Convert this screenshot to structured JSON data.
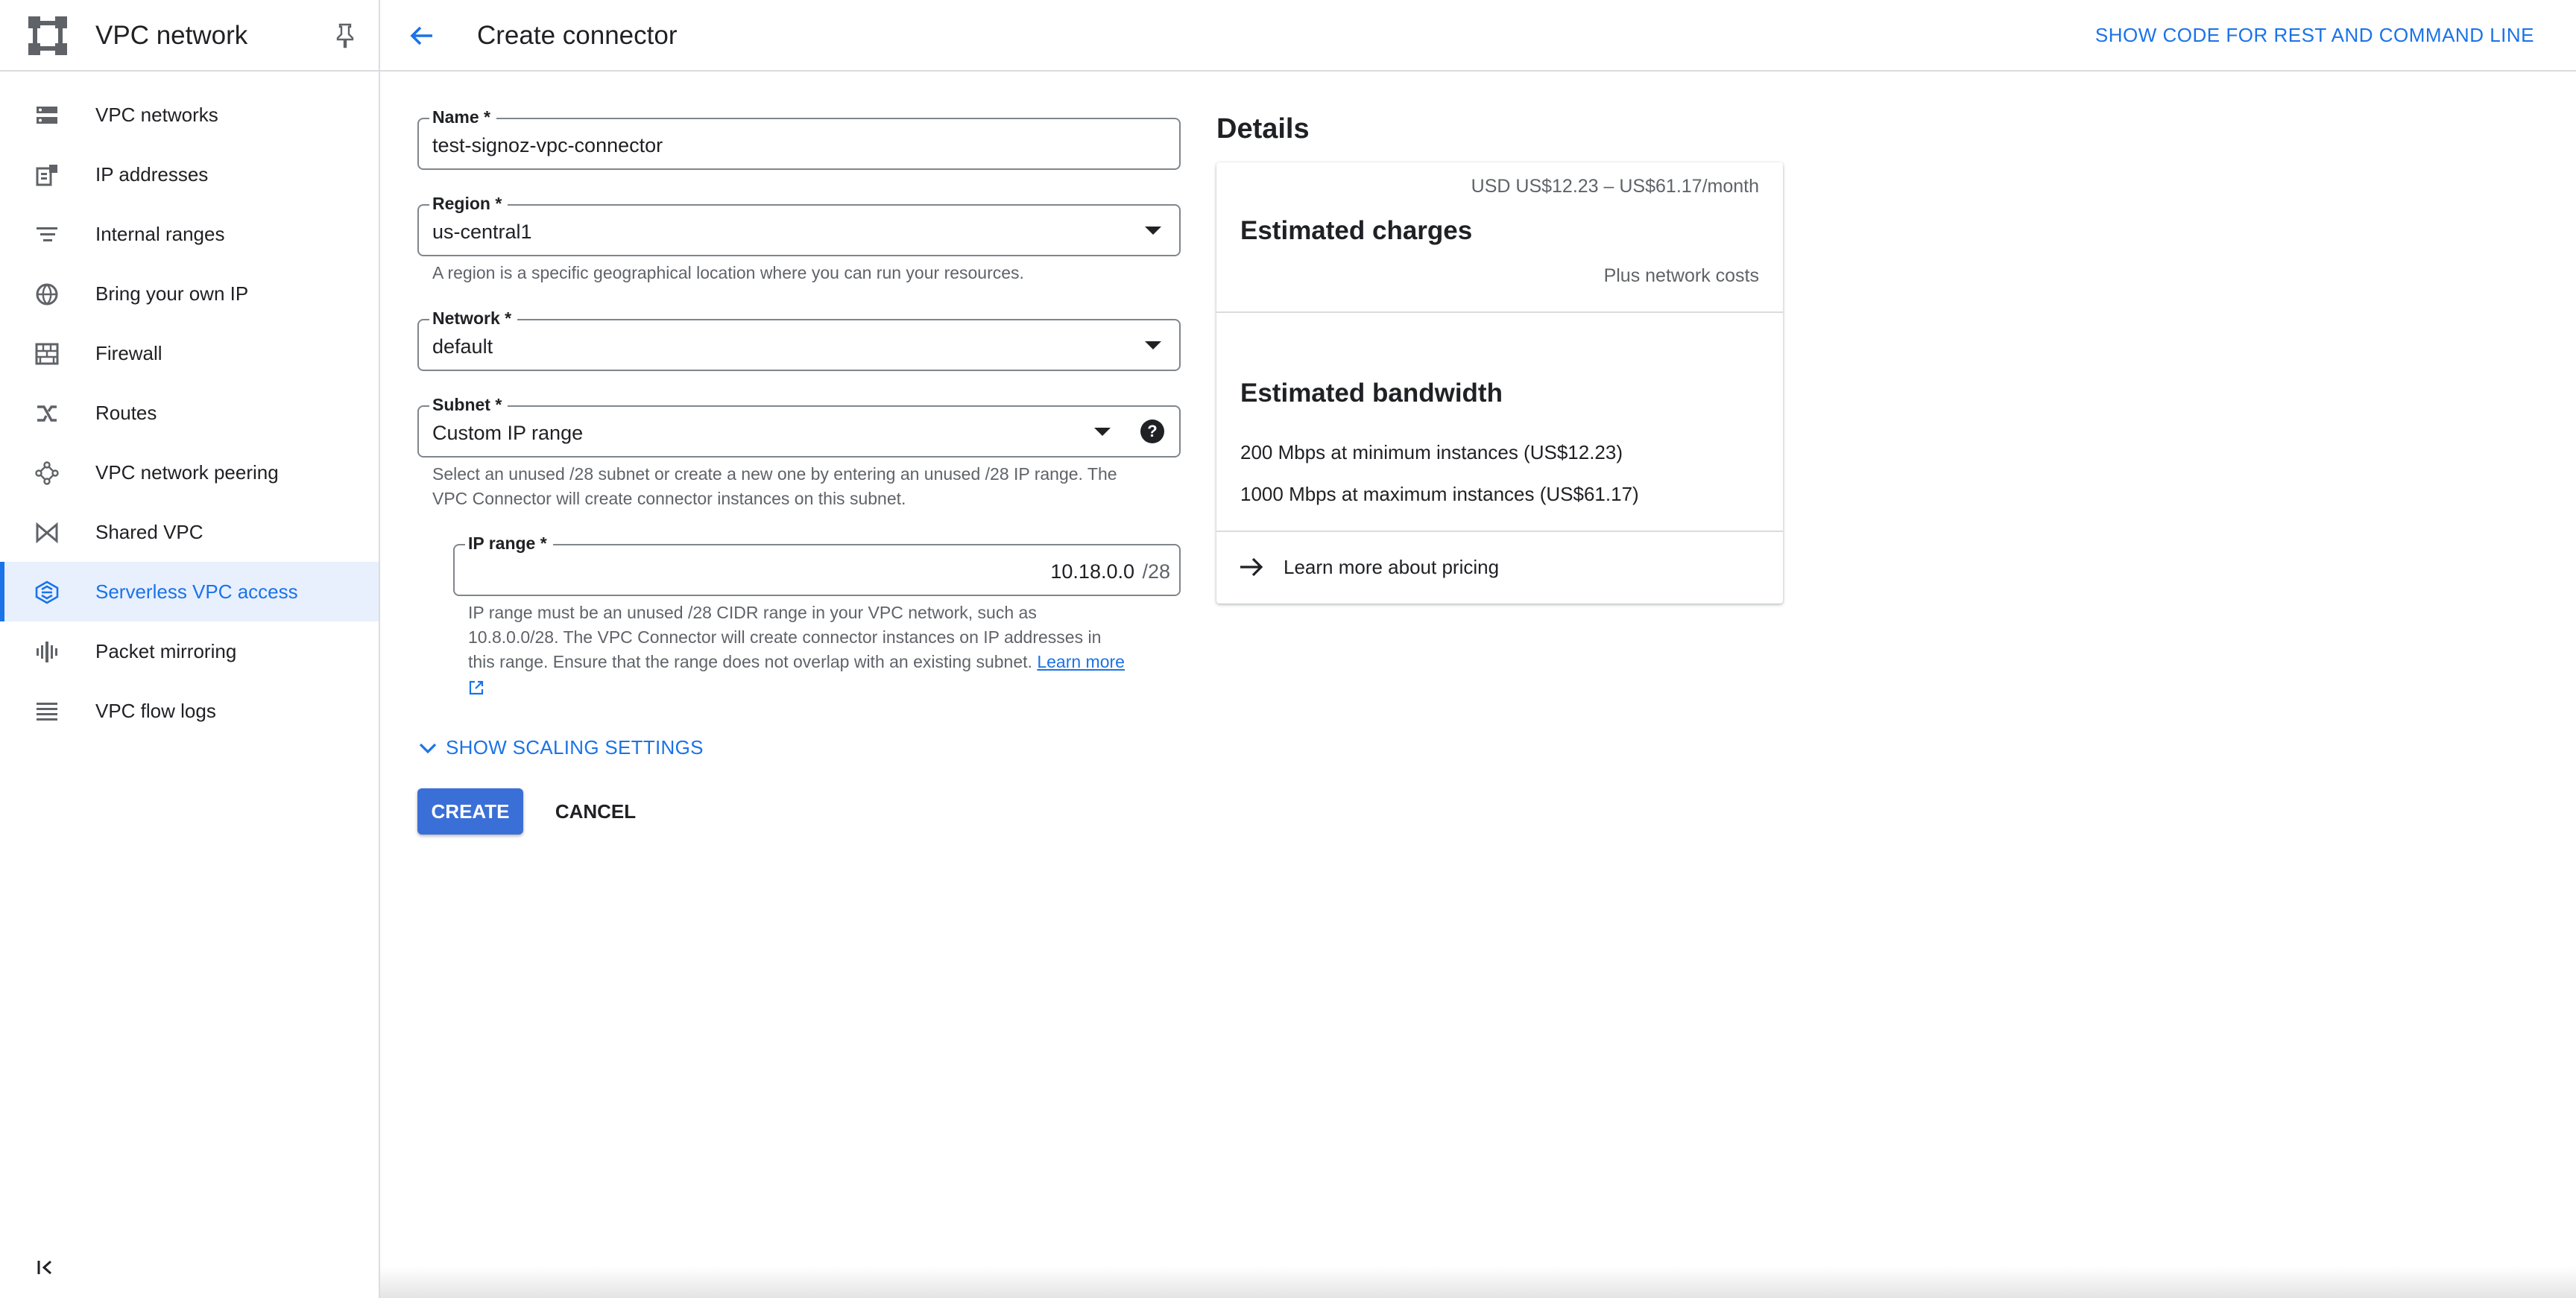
{
  "sidebar": {
    "title": "VPC network",
    "items": [
      {
        "label": "VPC networks",
        "icon": "vpc-networks-icon"
      },
      {
        "label": "IP addresses",
        "icon": "ip-addresses-icon"
      },
      {
        "label": "Internal ranges",
        "icon": "internal-ranges-icon"
      },
      {
        "label": "Bring your own IP",
        "icon": "globe-icon"
      },
      {
        "label": "Firewall",
        "icon": "firewall-icon"
      },
      {
        "label": "Routes",
        "icon": "routes-icon"
      },
      {
        "label": "VPC network peering",
        "icon": "peering-icon"
      },
      {
        "label": "Shared VPC",
        "icon": "shared-vpc-icon"
      },
      {
        "label": "Serverless VPC access",
        "icon": "serverless-icon",
        "active": true
      },
      {
        "label": "Packet mirroring",
        "icon": "packet-mirroring-icon"
      },
      {
        "label": "VPC flow logs",
        "icon": "flow-logs-icon"
      }
    ]
  },
  "header": {
    "title": "Create connector",
    "show_code": "SHOW CODE FOR REST AND COMMAND LINE"
  },
  "form": {
    "name": {
      "label": "Name *",
      "value": "test-signoz-vpc-connector"
    },
    "region": {
      "label": "Region *",
      "value": "us-central1",
      "hint": "A region is a specific geographical location where you can run your resources."
    },
    "network": {
      "label": "Network *",
      "value": "default"
    },
    "subnet": {
      "label": "Subnet *",
      "value": "Custom IP range",
      "hint_line1": "Select an unused /28 subnet or create a new one by entering an unused /28 IP range. The",
      "hint_line2": "VPC Connector will create connector instances on this subnet."
    },
    "ip_range": {
      "label": "IP range *",
      "value": "10.18.0.0",
      "suffix": "/28",
      "hint_line1": "IP range must be an unused /28 CIDR range in your VPC network, such as",
      "hint_line2": "10.8.0.0/28. The VPC Connector will create connector instances on IP addresses in",
      "hint_line3": "this range. Ensure that the range does not overlap with an existing subnet.",
      "learn_more": "Learn more"
    },
    "scaling": "SHOW SCALING SETTINGS",
    "create": "CREATE",
    "cancel": "CANCEL"
  },
  "details": {
    "title": "Details",
    "price_range": "USD US$12.23 – US$61.17/month",
    "estimated_charges": "Estimated charges",
    "network_costs": "Plus network costs",
    "estimated_bandwidth": "Estimated bandwidth",
    "bw_min": "200 Mbps at minimum instances (US$12.23)",
    "bw_max": "1000 Mbps at maximum instances (US$61.17)",
    "learn_pricing": "Learn more about pricing"
  },
  "colors": {
    "accent": "#1a73e8",
    "active_bg": "#e8f0fe",
    "text": "#202124",
    "muted": "#5f6368"
  }
}
